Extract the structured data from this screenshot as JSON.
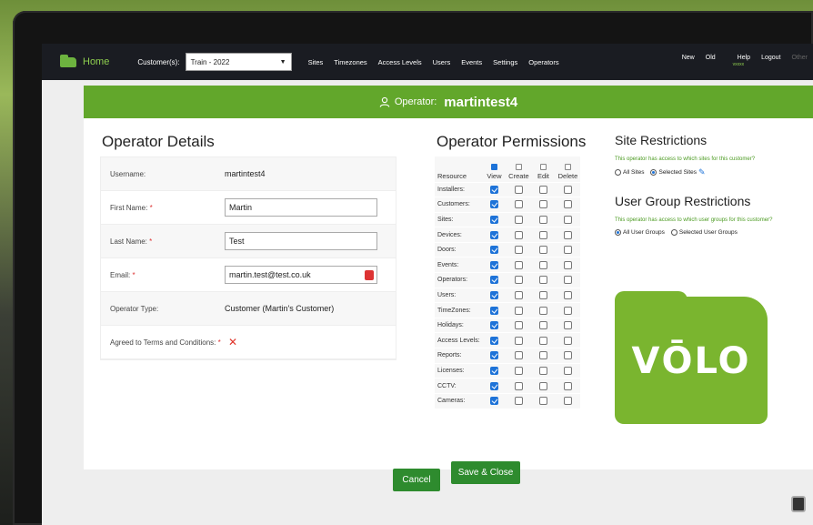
{
  "nav": {
    "home": "Home",
    "customer_label": "Customer(s):",
    "customer_value": "Train - 2022",
    "menu": [
      "Sites",
      "Timezones",
      "Access Levels",
      "Users",
      "Events",
      "Settings",
      "Operators"
    ],
    "right": {
      "new": "New",
      "old": "Old",
      "help": "Help",
      "help_sub": "vxxxx",
      "logout": "Logout",
      "other": "Other"
    }
  },
  "banner": {
    "label": "Operator:",
    "value": "martintest4"
  },
  "details": {
    "title": "Operator Details",
    "username_label": "Username:",
    "username_value": "martintest4",
    "first_name_label": "First Name:",
    "first_name_value": "Martin",
    "last_name_label": "Last Name:",
    "last_name_value": "Test",
    "email_label": "Email:",
    "email_value": "martin.test@test.co.uk",
    "operator_type_label": "Operator Type:",
    "operator_type_value": "Customer (Martin's Customer)",
    "terms_label": "Agreed to Terms and Conditions:",
    "required_mark": "*"
  },
  "permissions": {
    "title": "Operator Permissions",
    "headers": [
      "Resource",
      "View",
      "Create",
      "Edit",
      "Delete"
    ],
    "header_checked": [
      true,
      false,
      false,
      false
    ],
    "rows": [
      {
        "name": "Installers:",
        "checks": [
          true,
          false,
          false,
          false
        ]
      },
      {
        "name": "Customers:",
        "checks": [
          true,
          false,
          false,
          false
        ]
      },
      {
        "name": "Sites:",
        "checks": [
          true,
          false,
          false,
          false
        ]
      },
      {
        "name": "Devices:",
        "checks": [
          true,
          false,
          false,
          false
        ]
      },
      {
        "name": "Doors:",
        "checks": [
          true,
          false,
          false,
          false
        ]
      },
      {
        "name": "Events:",
        "checks": [
          true,
          false,
          false,
          false
        ]
      },
      {
        "name": "Operators:",
        "checks": [
          true,
          false,
          false,
          false
        ]
      },
      {
        "name": "Users:",
        "checks": [
          true,
          false,
          false,
          false
        ]
      },
      {
        "name": "TimeZones:",
        "checks": [
          true,
          false,
          false,
          false
        ]
      },
      {
        "name": "Holidays:",
        "checks": [
          true,
          false,
          false,
          false
        ]
      },
      {
        "name": "Access Levels:",
        "checks": [
          true,
          false,
          false,
          false
        ]
      },
      {
        "name": "Reports:",
        "checks": [
          true,
          false,
          false,
          false
        ]
      },
      {
        "name": "Licenses:",
        "checks": [
          true,
          false,
          false,
          false
        ]
      },
      {
        "name": "CCTV:",
        "checks": [
          true,
          false,
          false,
          false
        ]
      },
      {
        "name": "Cameras:",
        "checks": [
          true,
          false,
          false,
          false
        ]
      }
    ]
  },
  "site_restrictions": {
    "title": "Site Restrictions",
    "help": "This operator has access to which sites for this customer?",
    "options": [
      "All Sites",
      "Selected Sites"
    ],
    "selected_index": 1
  },
  "user_group_restrictions": {
    "title": "User Group Restrictions",
    "help": "This operator has access to which user groups for this customer?",
    "options": [
      "All User Groups",
      "Selected User Groups"
    ],
    "selected_index": 0
  },
  "logo": {
    "text": "VŌLO"
  },
  "footer": {
    "cancel": "Cancel",
    "save": "Save & Close"
  },
  "colors": {
    "brand_green": "#62a72b",
    "nav_bg": "#1a1c22",
    "checkbox_blue": "#1e73d8",
    "button_green": "#2e8b2e"
  },
  "icons": {
    "banner": "user-icon",
    "email": "email-action-icon",
    "terms": "x-mark-icon",
    "edit": "pencil-icon"
  }
}
